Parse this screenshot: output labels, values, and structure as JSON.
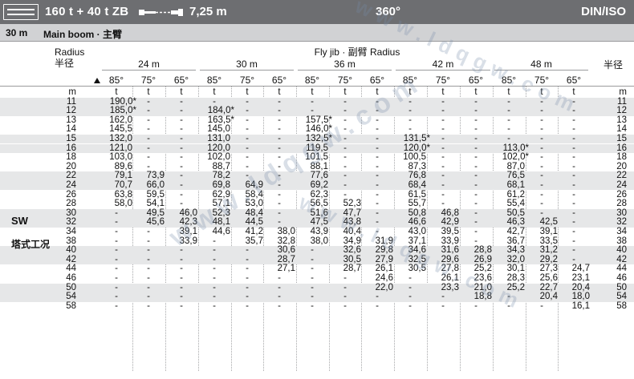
{
  "header": {
    "config": "160 t + 40 t ZB",
    "boom_icon": "boom-extension-icon",
    "boom_length": "7,25 m",
    "slew": "360°",
    "standard": "DIN/ISO"
  },
  "section": {
    "length": "30 m",
    "name": "Main boom · 主臂"
  },
  "columns": {
    "radius_label": "Radius",
    "radius_label_cn": "半径",
    "jib_title": "Fly jib · 副臂 Radius",
    "right_label_cn": "半径",
    "groups": [
      "24 m",
      "30 m",
      "36 m",
      "42 m",
      "48 m"
    ],
    "angles": [
      "85°",
      "75°",
      "65°",
      "85°",
      "75°",
      "65°",
      "85°",
      "75°",
      "65°",
      "85°",
      "75°",
      "65°",
      "85°",
      "75°",
      "65°"
    ],
    "unit_radius": "m",
    "unit_load": "t"
  },
  "side_labels": {
    "code": "SW",
    "mode_cn": "塔式工况"
  },
  "watermark": "www.ldqgw.com",
  "rows": [
    {
      "r": "11",
      "v": [
        "190,0*",
        "-",
        "-",
        "-",
        "-",
        "-",
        "-",
        "-",
        "-",
        "-",
        "-",
        "-",
        "-",
        "-",
        "-"
      ]
    },
    {
      "r": "12",
      "v": [
        "185,0*",
        "-",
        "-",
        "184,0*",
        "-",
        "-",
        "-",
        "-",
        "-",
        "-",
        "-",
        "-",
        "-",
        "-",
        "-"
      ]
    },
    {
      "r": "13",
      "v": [
        "162,0",
        "-",
        "-",
        "163,5*",
        "-",
        "-",
        "157,5*",
        "-",
        "-",
        "-",
        "-",
        "-",
        "-",
        "-",
        "-"
      ]
    },
    {
      "r": "14",
      "v": [
        "145,5",
        "-",
        "-",
        "145,0",
        "-",
        "-",
        "146,0*",
        "-",
        "-",
        "-",
        "-",
        "-",
        "-",
        "-",
        "-"
      ]
    },
    {
      "r": "15",
      "v": [
        "132,0",
        "-",
        "-",
        "131,0",
        "-",
        "-",
        "132,5*",
        "-",
        "-",
        "131,5*",
        "-",
        "-",
        "-",
        "-",
        "-"
      ]
    },
    {
      "r": "16",
      "v": [
        "121,0",
        "-",
        "-",
        "120,0",
        "-",
        "-",
        "119,5",
        "-",
        "-",
        "120,0*",
        "-",
        "-",
        "113,0*",
        "-",
        "-"
      ]
    },
    {
      "r": "18",
      "v": [
        "103,0",
        "-",
        "-",
        "102,0",
        "-",
        "-",
        "101,5",
        "-",
        "-",
        "100,5",
        "-",
        "-",
        "102,0*",
        "-",
        "-"
      ]
    },
    {
      "r": "20",
      "v": [
        "89,6",
        "-",
        "-",
        "88,7",
        "-",
        "-",
        "88,1",
        "-",
        "-",
        "87,3",
        "-",
        "-",
        "87,0",
        "-",
        "-"
      ]
    },
    {
      "r": "22",
      "v": [
        "79,1",
        "73,9",
        "-",
        "78,2",
        "-",
        "-",
        "77,6",
        "-",
        "-",
        "76,8",
        "-",
        "-",
        "76,5",
        "-",
        "-"
      ]
    },
    {
      "r": "24",
      "v": [
        "70,7",
        "66,0",
        "-",
        "69,8",
        "64,9",
        "-",
        "69,2",
        "-",
        "-",
        "68,4",
        "-",
        "-",
        "68,1",
        "-",
        "-"
      ]
    },
    {
      "r": "26",
      "v": [
        "63,8",
        "59,5",
        "-",
        "62,9",
        "58,4",
        "-",
        "62,3",
        "-",
        "-",
        "61,5",
        "-",
        "-",
        "61,2",
        "-",
        "-"
      ]
    },
    {
      "r": "28",
      "v": [
        "58,0",
        "54,1",
        "-",
        "57,1",
        "53,0",
        "-",
        "56,5",
        "52,3",
        "-",
        "55,7",
        "-",
        "-",
        "55,4",
        "-",
        "-"
      ]
    },
    {
      "r": "30",
      "v": [
        "-",
        "49,5",
        "46,0",
        "52,3",
        "48,4",
        "-",
        "51,6",
        "47,7",
        "-",
        "50,8",
        "46,8",
        "-",
        "50,5",
        "-",
        "-"
      ]
    },
    {
      "r": "32",
      "v": [
        "-",
        "45,6",
        "42,3",
        "48,1",
        "44,5",
        "-",
        "47,5",
        "43,8",
        "-",
        "46,6",
        "42,9",
        "-",
        "46,3",
        "42,5",
        "-"
      ]
    },
    {
      "r": "34",
      "v": [
        "-",
        "-",
        "39,1",
        "44,6",
        "41,2",
        "38,0",
        "43,9",
        "40,4",
        "-",
        "43,0",
        "39,5",
        "-",
        "42,7",
        "39,1",
        "-"
      ]
    },
    {
      "r": "38",
      "v": [
        "-",
        "-",
        "33,9",
        "-",
        "35,7",
        "32,8",
        "38,0",
        "34,9",
        "31,9",
        "37,1",
        "33,9",
        "-",
        "36,7",
        "33,5",
        "-"
      ]
    },
    {
      "r": "40",
      "v": [
        "-",
        "-",
        "-",
        "-",
        "-",
        "30,6",
        "-",
        "32,6",
        "29,8",
        "34,6",
        "31,6",
        "28,8",
        "34,3",
        "31,2",
        "-"
      ]
    },
    {
      "r": "42",
      "v": [
        "-",
        "-",
        "-",
        "-",
        "-",
        "28,7",
        "-",
        "30,5",
        "27,9",
        "32,5",
        "29,6",
        "26,9",
        "32,0",
        "29,2",
        "-"
      ]
    },
    {
      "r": "44",
      "v": [
        "-",
        "-",
        "-",
        "-",
        "-",
        "27,1",
        "-",
        "28,7",
        "26,1",
        "30,5",
        "27,8",
        "25,2",
        "30,1",
        "27,3",
        "24,7"
      ]
    },
    {
      "r": "46",
      "v": [
        "-",
        "-",
        "-",
        "-",
        "-",
        "-",
        "-",
        "-",
        "24,6",
        "-",
        "26,1",
        "23,6",
        "28,3",
        "25,6",
        "23,1"
      ]
    },
    {
      "r": "50",
      "v": [
        "-",
        "-",
        "-",
        "-",
        "-",
        "-",
        "-",
        "-",
        "22,0",
        "-",
        "23,3",
        "21,0",
        "25,2",
        "22,7",
        "20,4"
      ]
    },
    {
      "r": "54",
      "v": [
        "-",
        "-",
        "-",
        "-",
        "-",
        "-",
        "-",
        "-",
        "-",
        "-",
        "-",
        "18,8",
        "-",
        "20,4",
        "18,0"
      ]
    },
    {
      "r": "58",
      "v": [
        "-",
        "-",
        "-",
        "-",
        "-",
        "-",
        "-",
        "-",
        "-",
        "-",
        "-",
        "-",
        "-",
        "-",
        "16,1"
      ]
    }
  ]
}
